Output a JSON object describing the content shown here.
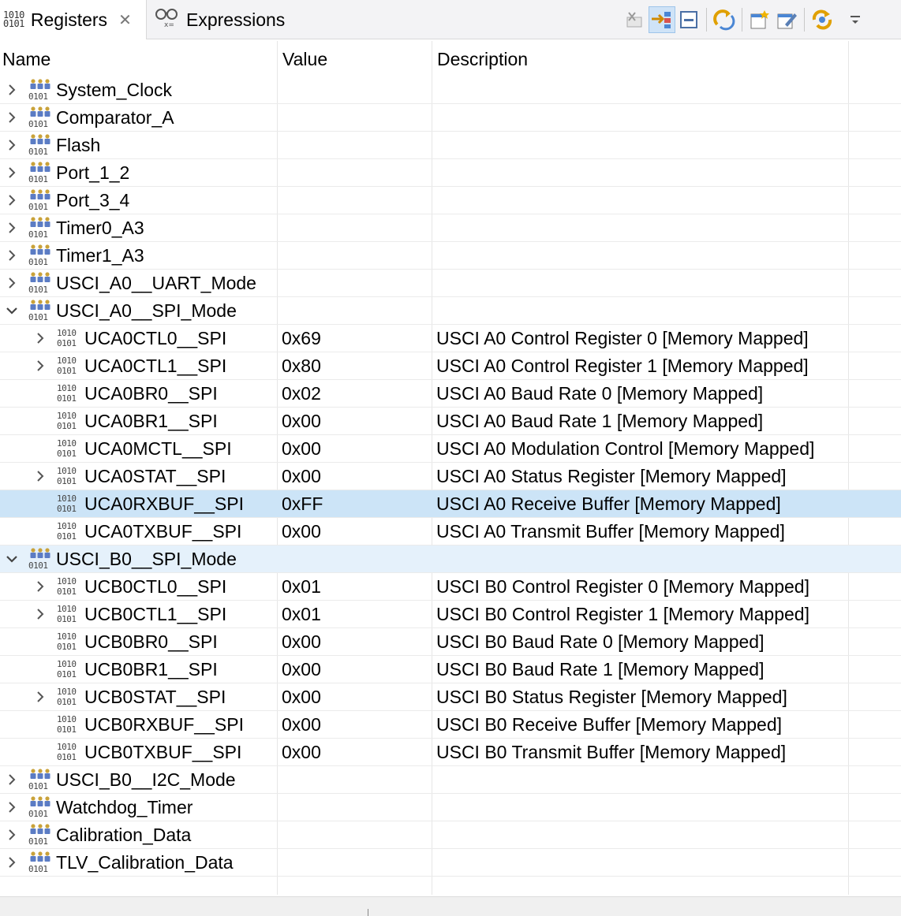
{
  "tabs": [
    {
      "label": "Registers",
      "active": true,
      "icon": "binary-icon"
    },
    {
      "label": "Expressions",
      "active": false,
      "icon": "glasses-icon"
    }
  ],
  "binary_glyph": [
    "1010",
    "0101"
  ],
  "toolbar_icons": [
    "remove-all-icon",
    "link-with-selection-icon",
    "collapse-all-icon",
    "refresh-icon",
    "new-group-icon",
    "edit-icon",
    "continuous-refresh-icon",
    "view-menu-icon"
  ],
  "columns": {
    "name": "Name",
    "value": "Value",
    "description": "Description"
  },
  "rows": [
    {
      "level": 0,
      "expander": "collapsed",
      "type": "group",
      "name": "System_Clock",
      "value": "",
      "description": ""
    },
    {
      "level": 0,
      "expander": "collapsed",
      "type": "group",
      "name": "Comparator_A",
      "value": "",
      "description": ""
    },
    {
      "level": 0,
      "expander": "collapsed",
      "type": "group",
      "name": "Flash",
      "value": "",
      "description": ""
    },
    {
      "level": 0,
      "expander": "collapsed",
      "type": "group",
      "name": "Port_1_2",
      "value": "",
      "description": ""
    },
    {
      "level": 0,
      "expander": "collapsed",
      "type": "group",
      "name": "Port_3_4",
      "value": "",
      "description": ""
    },
    {
      "level": 0,
      "expander": "collapsed",
      "type": "group",
      "name": "Timer0_A3",
      "value": "",
      "description": ""
    },
    {
      "level": 0,
      "expander": "collapsed",
      "type": "group",
      "name": "Timer1_A3",
      "value": "",
      "description": ""
    },
    {
      "level": 0,
      "expander": "collapsed",
      "type": "group",
      "name": "USCI_A0__UART_Mode",
      "value": "",
      "description": ""
    },
    {
      "level": 0,
      "expander": "expanded",
      "type": "group",
      "name": "USCI_A0__SPI_Mode",
      "value": "",
      "description": ""
    },
    {
      "level": 1,
      "expander": "collapsed",
      "type": "register",
      "name": "UCA0CTL0__SPI",
      "value": "0x69",
      "description": "USCI A0 Control Register 0 [Memory Mapped]"
    },
    {
      "level": 1,
      "expander": "collapsed",
      "type": "register",
      "name": "UCA0CTL1__SPI",
      "value": "0x80",
      "description": "USCI A0 Control Register 1 [Memory Mapped]"
    },
    {
      "level": 1,
      "expander": "none",
      "type": "register",
      "name": "UCA0BR0__SPI",
      "value": "0x02",
      "description": "USCI A0 Baud Rate 0 [Memory Mapped]"
    },
    {
      "level": 1,
      "expander": "none",
      "type": "register",
      "name": "UCA0BR1__SPI",
      "value": "0x00",
      "description": "USCI A0 Baud Rate 1 [Memory Mapped]"
    },
    {
      "level": 1,
      "expander": "none",
      "type": "register",
      "name": "UCA0MCTL__SPI",
      "value": "0x00",
      "description": "USCI A0 Modulation Control [Memory Mapped]"
    },
    {
      "level": 1,
      "expander": "collapsed",
      "type": "register",
      "name": "UCA0STAT__SPI",
      "value": "0x00",
      "description": "USCI A0 Status Register [Memory Mapped]"
    },
    {
      "level": 1,
      "expander": "none",
      "type": "register",
      "name": "UCA0RXBUF__SPI",
      "value": "0xFF",
      "description": "USCI A0 Receive Buffer [Memory Mapped]",
      "state": "selected"
    },
    {
      "level": 1,
      "expander": "none",
      "type": "register",
      "name": "UCA0TXBUF__SPI",
      "value": "0x00",
      "description": "USCI A0 Transmit Buffer [Memory Mapped]"
    },
    {
      "level": 0,
      "expander": "expanded",
      "type": "group",
      "name": "USCI_B0__SPI_Mode",
      "value": "",
      "description": "",
      "state": "hover"
    },
    {
      "level": 1,
      "expander": "collapsed",
      "type": "register",
      "name": "UCB0CTL0__SPI",
      "value": "0x01",
      "description": "USCI B0 Control Register 0 [Memory Mapped]"
    },
    {
      "level": 1,
      "expander": "collapsed",
      "type": "register",
      "name": "UCB0CTL1__SPI",
      "value": "0x01",
      "description": "USCI B0 Control Register 1 [Memory Mapped]"
    },
    {
      "level": 1,
      "expander": "none",
      "type": "register",
      "name": "UCB0BR0__SPI",
      "value": "0x00",
      "description": "USCI B0 Baud Rate 0 [Memory Mapped]"
    },
    {
      "level": 1,
      "expander": "none",
      "type": "register",
      "name": "UCB0BR1__SPI",
      "value": "0x00",
      "description": "USCI B0 Baud Rate 1 [Memory Mapped]"
    },
    {
      "level": 1,
      "expander": "collapsed",
      "type": "register",
      "name": "UCB0STAT__SPI",
      "value": "0x00",
      "description": "USCI B0 Status Register [Memory Mapped]"
    },
    {
      "level": 1,
      "expander": "none",
      "type": "register",
      "name": "UCB0RXBUF__SPI",
      "value": "0x00",
      "description": "USCI B0 Receive Buffer [Memory Mapped]"
    },
    {
      "level": 1,
      "expander": "none",
      "type": "register",
      "name": "UCB0TXBUF__SPI",
      "value": "0x00",
      "description": "USCI B0 Transmit Buffer [Memory Mapped]"
    },
    {
      "level": 0,
      "expander": "collapsed",
      "type": "group",
      "name": "USCI_B0__I2C_Mode",
      "value": "",
      "description": ""
    },
    {
      "level": 0,
      "expander": "collapsed",
      "type": "group",
      "name": "Watchdog_Timer",
      "value": "",
      "description": ""
    },
    {
      "level": 0,
      "expander": "collapsed",
      "type": "group",
      "name": "Calibration_Data",
      "value": "",
      "description": ""
    },
    {
      "level": 0,
      "expander": "collapsed",
      "type": "group",
      "name": "TLV_Calibration_Data",
      "value": "",
      "description": ""
    }
  ],
  "colors": {
    "selected_row": "#cce4f7",
    "hover_row": "#e5f1fb",
    "accent": "#2e7bd6"
  }
}
